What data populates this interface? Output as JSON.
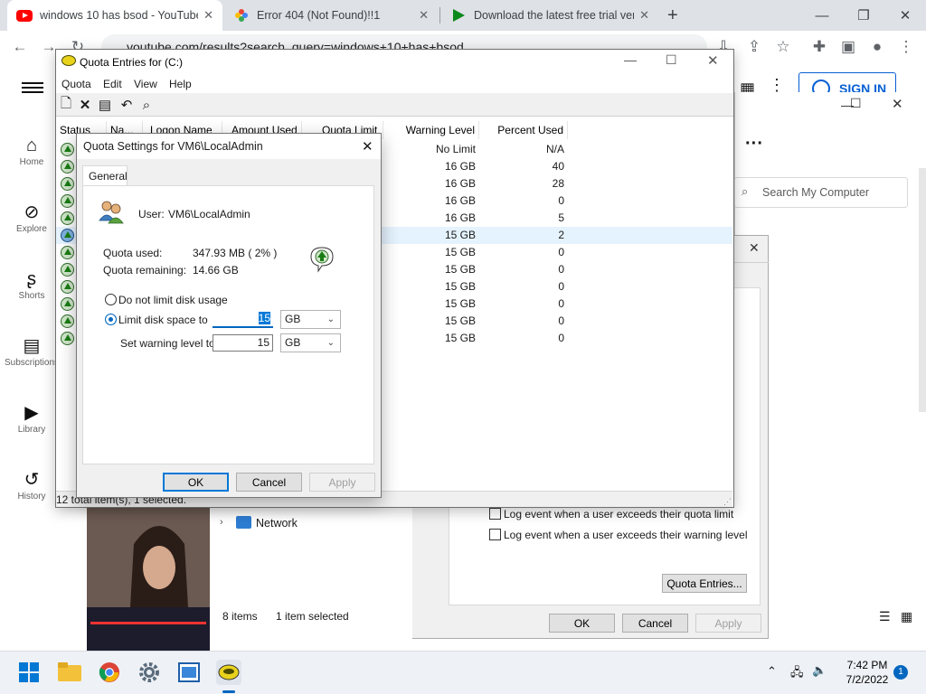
{
  "browser": {
    "tabs": [
      {
        "title": "windows 10 has bsod - YouTube",
        "active": true
      },
      {
        "title": "Error 404 (Not Found)!!1",
        "active": false
      },
      {
        "title": "Download the latest free trial ver",
        "active": false
      }
    ],
    "new_tab": "+",
    "url": "youtube.com/results?search_query=windows+10+has+bsod"
  },
  "youtube": {
    "nav": [
      {
        "label": "Home",
        "icon": "home-icon"
      },
      {
        "label": "Explore",
        "icon": "compass-icon"
      },
      {
        "label": "Shorts",
        "icon": "shorts-icon"
      },
      {
        "label": "Subscriptions",
        "icon": "subscriptions-icon"
      },
      {
        "label": "Library",
        "icon": "library-icon"
      },
      {
        "label": "History",
        "icon": "history-icon"
      }
    ],
    "sign_in": "SIGN IN"
  },
  "explorer": {
    "search_placeholder": "Search My Computer",
    "nav_item": "Network",
    "status_items": "8 items",
    "status_selected": "1 item selected"
  },
  "props_dialog": {
    "log_limit": "Log event when a user exceeds their quota limit",
    "log_warning": "Log event when a user exceeds their warning level",
    "quota_entries_btn": "Quota Entries...",
    "ok": "OK",
    "cancel": "Cancel",
    "apply": "Apply"
  },
  "quota_window": {
    "title": "Quota Entries for  (C:)",
    "menu": [
      "Quota",
      "Edit",
      "View",
      "Help"
    ],
    "columns": [
      "Status",
      "Na...",
      "Logon Name",
      "Amount Used",
      "Quota Limit",
      "Warning Level",
      "Percent Used"
    ],
    "rows": [
      {
        "warning": "No Limit",
        "percent": "N/A"
      },
      {
        "warning": "16 GB",
        "percent": "40"
      },
      {
        "warning": "16 GB",
        "percent": "28"
      },
      {
        "warning": "16 GB",
        "percent": "0"
      },
      {
        "warning": "16 GB",
        "percent": "5"
      },
      {
        "warning": "15 GB",
        "percent": "2"
      },
      {
        "warning": "15 GB",
        "percent": "0"
      },
      {
        "warning": "15 GB",
        "percent": "0"
      },
      {
        "warning": "15 GB",
        "percent": "0"
      },
      {
        "warning": "15 GB",
        "percent": "0"
      },
      {
        "warning": "15 GB",
        "percent": "0"
      },
      {
        "warning": "15 GB",
        "percent": "0"
      }
    ],
    "status": "12 total item(s), 1 selected."
  },
  "quota_settings": {
    "title": "Quota Settings for VM6\\LocalAdmin",
    "tab": "General",
    "user_label": "User:",
    "user_value": "VM6\\LocalAdmin",
    "used_label": "Quota used:",
    "used_value": "347.93 MB ( 2% )",
    "remaining_label": "Quota remaining:",
    "remaining_value": "14.66 GB",
    "no_limit": "Do not limit disk usage",
    "limit": "Limit disk space to",
    "limit_value": "15",
    "limit_unit": "GB",
    "warning_label": "Set warning level to",
    "warning_value": "15",
    "warning_unit": "GB",
    "ok": "OK",
    "cancel": "Cancel",
    "apply": "Apply"
  },
  "taskbar": {
    "time": "7:42 PM",
    "date": "7/2/2022",
    "notifications": "1"
  },
  "colors": {
    "accent": "#0067c0",
    "youtube_red": "#ff0000",
    "selection": "#e5f3ff"
  }
}
